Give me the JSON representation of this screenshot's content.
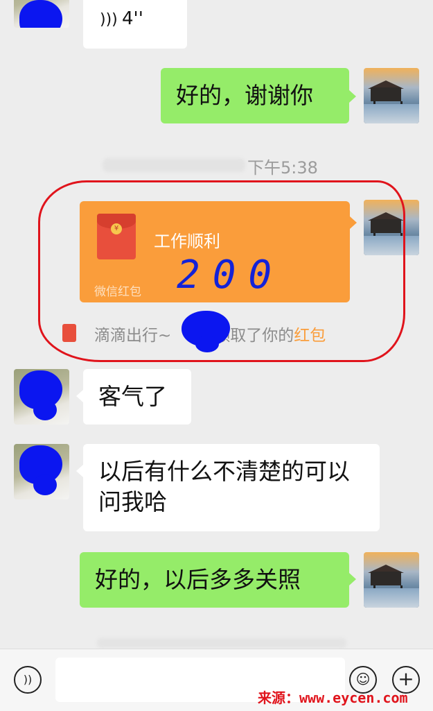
{
  "messages": {
    "voice": {
      "duration": "4''"
    },
    "thanks": "好的，谢谢你",
    "timestamp": "下午5:38",
    "red_packet": {
      "title": "工作顺利",
      "footer": "微信红包",
      "handwritten_amount": "200"
    },
    "notice": {
      "prefix": "滴滴出行~",
      "suffix": "领取了你的",
      "highlight": "红包"
    },
    "reply_1": "客气了",
    "reply_2": "以后有什么不清楚的可以问我哈",
    "reply_3": "好的，以后多多关照"
  },
  "input_bar": {
    "voice_icon": "voice-icon",
    "emoji_icon": "emoji-icon",
    "add_icon": "plus-icon",
    "value": ""
  },
  "watermark": "来源：www.eycen.com",
  "colors": {
    "background": "#ededed",
    "sent_bubble": "#95ec69",
    "received_bubble": "#ffffff",
    "red_packet": "#fa9d3b",
    "annotation": "#e0141c",
    "redaction": "#0b16f0"
  }
}
